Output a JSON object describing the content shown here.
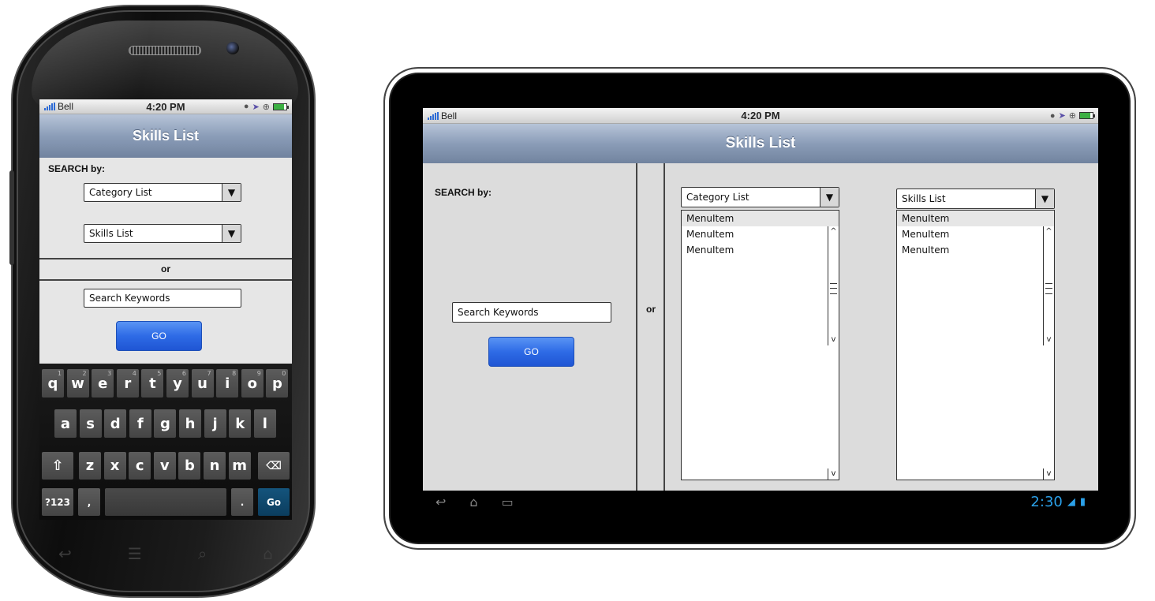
{
  "status_bar": {
    "carrier": "Bell",
    "time": "4:20 PM"
  },
  "phone": {
    "title": "Skills List",
    "search_by_label": "SEARCH by:",
    "category_dropdown": "Category List",
    "skills_dropdown": "Skills List",
    "or_label": "or",
    "keywords_input": "Search Keywords",
    "go_button": "GO",
    "keyboard": {
      "row1": [
        {
          "key": "q",
          "alt": "1"
        },
        {
          "key": "w",
          "alt": "2"
        },
        {
          "key": "e",
          "alt": "3"
        },
        {
          "key": "r",
          "alt": "4"
        },
        {
          "key": "t",
          "alt": "5"
        },
        {
          "key": "y",
          "alt": "6"
        },
        {
          "key": "u",
          "alt": "7"
        },
        {
          "key": "i",
          "alt": "8"
        },
        {
          "key": "o",
          "alt": "9"
        },
        {
          "key": "p",
          "alt": "0"
        }
      ],
      "row2": [
        "a",
        "s",
        "d",
        "f",
        "g",
        "h",
        "j",
        "k",
        "l"
      ],
      "row3": [
        "z",
        "x",
        "c",
        "v",
        "b",
        "n",
        "m"
      ],
      "symbols_key": "?123",
      "comma_key": ",",
      "period_key": ".",
      "go_key": "Go"
    }
  },
  "tablet": {
    "title": "Skills List",
    "search_by_label": "SEARCH by:",
    "keywords_input": "Search Keywords",
    "go_button": "GO",
    "or_label": "or",
    "category_dropdown": "Category List",
    "skills_dropdown": "Skills List",
    "category_items": [
      "MenuItem",
      "MenuItem",
      "MenuItem"
    ],
    "skills_items": [
      "MenuItem",
      "MenuItem",
      "MenuItem"
    ],
    "system_clock": "2:30"
  },
  "colors": {
    "nav_bar": "#8b9db8",
    "go_button": "#2e6be6",
    "system_clock": "#2ba0e8",
    "keyboard_go": "#14547c"
  }
}
